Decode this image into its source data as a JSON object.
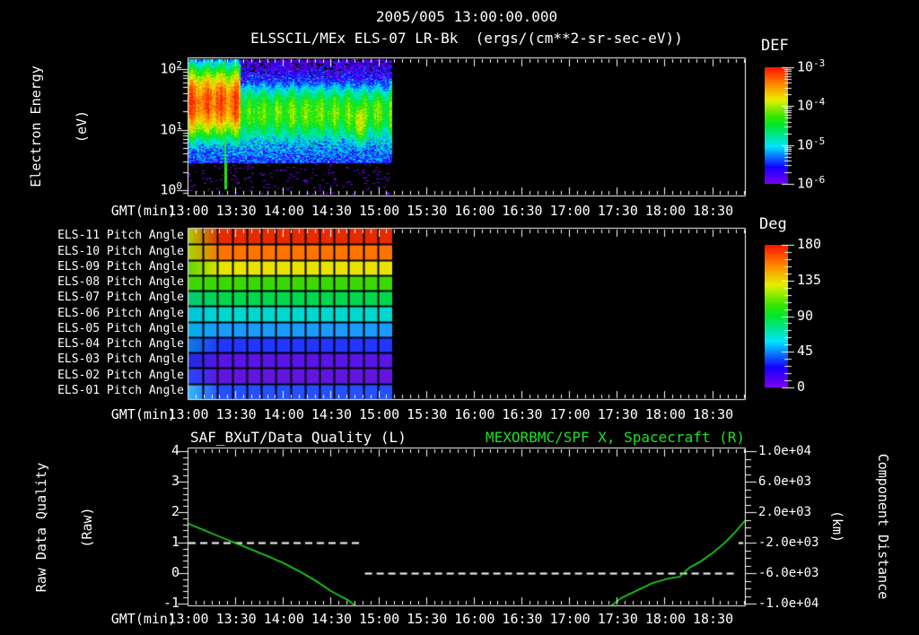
{
  "figure": {
    "date_title": "2005/005 13:00:00.000",
    "subtitle": "ELSSCIL/MEx ELS-07 LR-Bk  (ergs/(cm**2-sr-sec-eV))",
    "background": "#000000",
    "text_color": "#ffffff",
    "green": "#1ee01e"
  },
  "time_axis": {
    "label": "GMT(min)",
    "tick_labels": [
      "13:00",
      "13:30",
      "14:00",
      "14:30",
      "15:00",
      "15:30",
      "16:00",
      "16:30",
      "17:00",
      "17:30",
      "18:00",
      "18:30"
    ],
    "major_interval_min": 30,
    "minor_interval_min": 5,
    "span_min": [
      0,
      350
    ]
  },
  "colormap_stops": [
    [
      0.0,
      "#7a00f0"
    ],
    [
      0.14,
      "#1400ff"
    ],
    [
      0.32,
      "#00e4ff"
    ],
    [
      0.5,
      "#00e62e"
    ],
    [
      0.58,
      "#35e600"
    ],
    [
      0.72,
      "#e6f000"
    ],
    [
      0.85,
      "#ff8c00"
    ],
    [
      1.0,
      "#ff1400"
    ]
  ],
  "chart_data": [
    {
      "type": "heatmap",
      "name": "electron-energy-spectrogram",
      "title": "ELSSCIL/MEx ELS-07 LR-Bk  (ergs/(cm**2-sr-sec-eV))",
      "ylabel_lines": [
        "Electron Energy",
        "(eV)"
      ],
      "yticks_pow10": [
        "2",
        "1",
        "0"
      ],
      "yrange_ev_log10": [
        -0.09,
        2.27
      ],
      "colorbar": {
        "title": "DEF",
        "ticks_pow10": [
          "-3",
          "-4",
          "-5",
          "-6"
        ],
        "range_log10": [
          -6,
          -3
        ]
      },
      "data_time_span_min": [
        0,
        128
      ],
      "display_time_span_min": [
        0,
        350
      ],
      "summary": "Electron spectrogram 13:00-15:08 only. Intense 10-80 eV flux (~1e-3.3, red/orange) until ~13:33; moderate green band ~4-40 eV (~1e-4.3) after; brighter yellow-green patch 14:35-15:02; narrow green streak to low energies at ~13:23; sparse violet counts below ~3 eV; blue noise above ~40 eV; black (no data) after 15:08.",
      "model": {
        "hot_end_min": 33,
        "hot": {
          "center_log10ev": 1.45,
          "width": 0.52,
          "peak_log10flux": -3.3
        },
        "quiet": {
          "center_log10ev": 1.28,
          "width": 0.46,
          "peak_log10flux": -4.25
        },
        "late_blob": {
          "center_min": 108,
          "sigma_min": 10,
          "center_log10ev": 1.15,
          "width": 0.38,
          "peak_log10flux": -3.85
        },
        "high_energy_noise_log10flux": -5.2,
        "low_fringe": {
          "log10ev_range": [
            0.5,
            0.95
          ],
          "log10flux": -4.9
        },
        "sparse_dots": {
          "log10ev_max": 0.5,
          "probability": 0.055,
          "log10flux": -5.85
        },
        "streak": {
          "t_min": 23,
          "log10flux": -4.35
        }
      }
    },
    {
      "type": "heatmap",
      "name": "pitch-angle-panel",
      "colorbar": {
        "title": "Deg",
        "ticks": [
          180,
          135,
          90,
          45,
          0
        ],
        "range": [
          0,
          180
        ]
      },
      "data_time_span_min": [
        0,
        128
      ],
      "display_time_span_min": [
        0,
        350
      ],
      "grid_cells": 14,
      "rows": [
        {
          "label": "ELS-11 Pitch Angle",
          "pitch_deg": 172,
          "color": "#e62b00",
          "left_color": "#b4cc00"
        },
        {
          "label": "ELS-10 Pitch Angle",
          "pitch_deg": 155,
          "color": "#ff7300",
          "left_color": "#a6d400"
        },
        {
          "label": "ELS-09 Pitch Angle",
          "pitch_deg": 133,
          "color": "#e8e400",
          "left_color": "#5fd800"
        },
        {
          "label": "ELS-08 Pitch Angle",
          "pitch_deg": 112,
          "color": "#3cd900",
          "left_color": "#3cd900"
        },
        {
          "label": "ELS-07 Pitch Angle",
          "pitch_deg": 95,
          "color": "#00d84d",
          "left_color": "#00cc74"
        },
        {
          "label": "ELS-06 Pitch Angle",
          "pitch_deg": 78,
          "color": "#00d8cf",
          "left_color": "#00c4da"
        },
        {
          "label": "ELS-05 Pitch Angle",
          "pitch_deg": 62,
          "color": "#1b9aff",
          "left_color": "#00b2ea"
        },
        {
          "label": "ELS-04 Pitch Angle",
          "pitch_deg": 44,
          "color": "#2336ff",
          "left_color": "#0b7ce0"
        },
        {
          "label": "ELS-03 Pitch Angle",
          "pitch_deg": 22,
          "color": "#5a14e6",
          "left_color": "#1e2ce0"
        },
        {
          "label": "ELS-02 Pitch Angle",
          "pitch_deg": 14,
          "color": "#6414e0",
          "left_color": "#2347ff"
        },
        {
          "label": "ELS-01 Pitch Angle",
          "pitch_deg": 47,
          "color": "#2450ff",
          "left_color": "#38b8ff"
        }
      ]
    },
    {
      "type": "line",
      "name": "quality-and-spacecraft-distance",
      "title_left": "SAF_BXuT/Data Quality (L)",
      "title_right": "MEXORBMC/SPF X, Spacecraft (R)",
      "left_axis": {
        "label_lines": [
          "Raw Data Quality",
          "(Raw)"
        ],
        "ticks": [
          4,
          3,
          2,
          1,
          0,
          -1
        ],
        "range": [
          -1,
          4
        ]
      },
      "right_axis": {
        "label_lines": [
          "Component Distance",
          "(km)"
        ],
        "tick_labels": [
          "1.0e+04",
          "6.0e+03",
          "2.0e+03",
          "-2.0e+03",
          "-6.0e+03",
          "-1.0e+04"
        ],
        "range": [
          -10000,
          10000
        ]
      },
      "series": [
        {
          "name": "SAF_BXuT/Data Quality",
          "axis": "left",
          "style": "dashed",
          "color": "#ffffff",
          "segments": [
            {
              "t_min": [
                0,
                109
              ],
              "value": 1
            },
            {
              "t_min": [
                111,
                343
              ],
              "value": 0
            },
            {
              "t_min": [
                346,
                349
              ],
              "value": 1
            }
          ]
        },
        {
          "name": "MEXORBMC/SPF X Spacecraft",
          "axis": "right",
          "style": "solid",
          "color": "#1ee01e",
          "points_min_km": [
            [
              0,
              470
            ],
            [
              10,
              -380
            ],
            [
              20,
              -1250
            ],
            [
              30,
              -2100
            ],
            [
              40,
              -2950
            ],
            [
              50,
              -3800
            ],
            [
              60,
              -4700
            ],
            [
              70,
              -5800
            ],
            [
              80,
              -7000
            ],
            [
              90,
              -8400
            ],
            [
              100,
              -9500
            ],
            [
              107,
              -10600
            ],
            [
              264,
              -10600
            ],
            [
              272,
              -9300
            ],
            [
              282,
              -8300
            ],
            [
              292,
              -7300
            ],
            [
              302,
              -6700
            ],
            [
              309,
              -6470
            ],
            [
              315,
              -5300
            ],
            [
              322,
              -4500
            ],
            [
              330,
              -3300
            ],
            [
              338,
              -1900
            ],
            [
              344,
              -600
            ],
            [
              350,
              850
            ]
          ]
        }
      ]
    }
  ]
}
